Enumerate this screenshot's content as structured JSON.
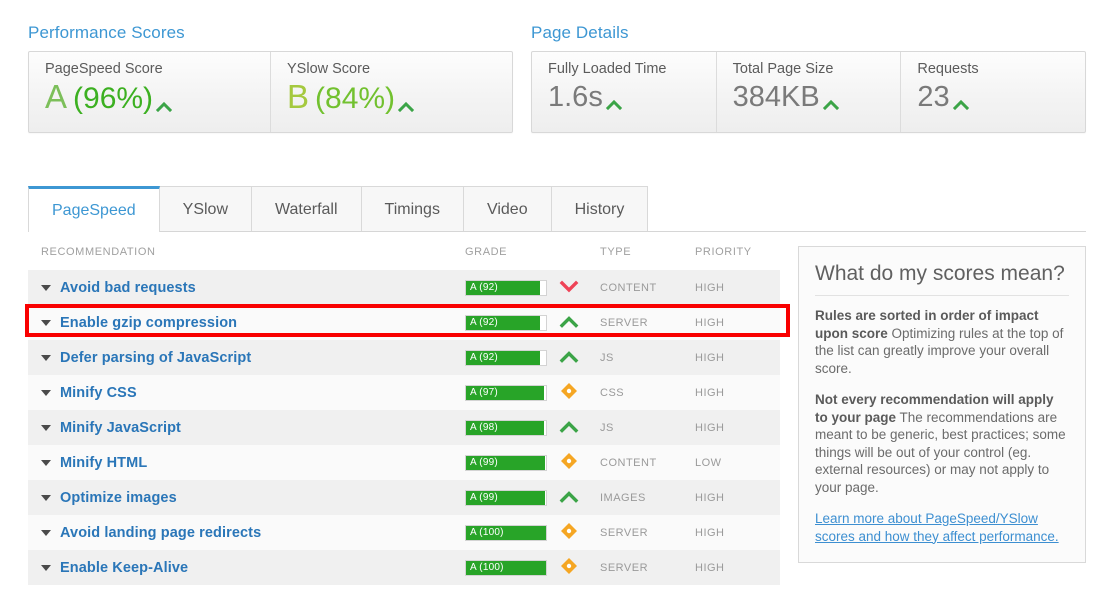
{
  "performance": {
    "title": "Performance Scores",
    "scores": [
      {
        "label": "PageSpeed Score",
        "grade": "A",
        "percent": "(96%)",
        "grade_color": "#7cbf5a",
        "pct_color": "#3cb021",
        "trend": "up"
      },
      {
        "label": "YSlow Score",
        "grade": "B",
        "percent": "(84%)",
        "grade_color": "#a5c93f",
        "pct_color": "#72c12f",
        "trend": "up"
      }
    ]
  },
  "page_details": {
    "title": "Page Details",
    "metrics": [
      {
        "label": "Fully Loaded Time",
        "value": "1.6s",
        "trend": "up"
      },
      {
        "label": "Total Page Size",
        "value": "384KB",
        "trend": "up"
      },
      {
        "label": "Requests",
        "value": "23",
        "trend": "up"
      }
    ]
  },
  "tabs": [
    {
      "label": "PageSpeed",
      "active": true
    },
    {
      "label": "YSlow",
      "active": false
    },
    {
      "label": "Waterfall",
      "active": false
    },
    {
      "label": "Timings",
      "active": false
    },
    {
      "label": "Video",
      "active": false
    },
    {
      "label": "History",
      "active": false
    }
  ],
  "table": {
    "headers": {
      "recommendation": "RECOMMENDATION",
      "grade": "GRADE",
      "type": "TYPE",
      "priority": "PRIORITY"
    },
    "rows": [
      {
        "name": "Avoid bad requests",
        "grade": "A (92)",
        "score": 92,
        "type": "CONTENT",
        "priority": "HIGH",
        "trend": "down",
        "highlighted": false
      },
      {
        "name": "Enable gzip compression",
        "grade": "A (92)",
        "score": 92,
        "type": "SERVER",
        "priority": "HIGH",
        "trend": "up",
        "highlighted": true
      },
      {
        "name": "Defer parsing of JavaScript",
        "grade": "A (92)",
        "score": 92,
        "type": "JS",
        "priority": "HIGH",
        "trend": "up",
        "highlighted": false
      },
      {
        "name": "Minify CSS",
        "grade": "A (97)",
        "score": 97,
        "type": "CSS",
        "priority": "HIGH",
        "trend": "neutral",
        "highlighted": false
      },
      {
        "name": "Minify JavaScript",
        "grade": "A (98)",
        "score": 98,
        "type": "JS",
        "priority": "HIGH",
        "trend": "up",
        "highlighted": false
      },
      {
        "name": "Minify HTML",
        "grade": "A (99)",
        "score": 99,
        "type": "CONTENT",
        "priority": "LOW",
        "trend": "neutral",
        "highlighted": false
      },
      {
        "name": "Optimize images",
        "grade": "A (99)",
        "score": 99,
        "type": "IMAGES",
        "priority": "HIGH",
        "trend": "up",
        "highlighted": false
      },
      {
        "name": "Avoid landing page redirects",
        "grade": "A (100)",
        "score": 100,
        "type": "SERVER",
        "priority": "HIGH",
        "trend": "neutral",
        "highlighted": false
      },
      {
        "name": "Enable Keep-Alive",
        "grade": "A (100)",
        "score": 100,
        "type": "SERVER",
        "priority": "HIGH",
        "trend": "neutral",
        "highlighted": false
      }
    ]
  },
  "sidebar": {
    "title": "What do my scores mean?",
    "sections": [
      {
        "heading": "Rules are sorted in order of impact upon score",
        "body": "Optimizing rules at the top of the list can greatly improve your overall score."
      },
      {
        "heading": "Not every recommendation will apply to your page",
        "body": "The recommendations are meant to be generic, best practices; some things will be out of your control (eg. external resources) or may not apply to your page."
      }
    ],
    "link": "Learn more about PageSpeed/YSlow scores and how they affect performance."
  },
  "colors": {
    "accent_blue": "#3d97d3",
    "link_blue": "#2a76b8",
    "bar_green": "#28a428",
    "trend_up_green": "#3ba447",
    "trend_down_red": "#ef4357",
    "trend_neutral_orange": "#f5a623",
    "highlight_red": "#f90000"
  }
}
